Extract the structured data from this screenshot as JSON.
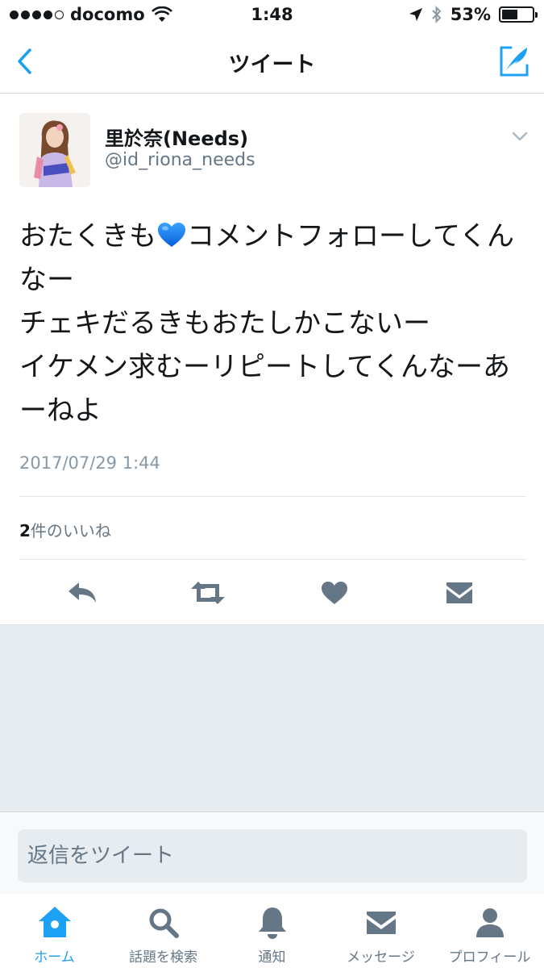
{
  "status_bar": {
    "carrier": "docomo",
    "time": "1:48",
    "battery_percent": "53%",
    "battery_level": 0.53
  },
  "nav": {
    "title": "ツイート",
    "back_icon": "chevron-left-icon",
    "compose_icon": "compose-tweet-icon"
  },
  "tweet": {
    "author_name": "里於奈(Needs)",
    "author_handle": "@id_riona_needs",
    "text_part1": "おたくきも",
    "text_part2": "コメントフォローしてくんなー\nチェキだるきもおたしかこないー\nイケメン求むーリピートしてくんなーあーねよ",
    "timestamp": "2017/07/29 1:44",
    "likes_count": "2",
    "likes_label": "件のいいね"
  },
  "reply": {
    "placeholder": "返信をツイート"
  },
  "tabs": [
    {
      "label": "ホーム",
      "icon": "home-icon",
      "active": true
    },
    {
      "label": "話題を検索",
      "icon": "search-icon",
      "active": false
    },
    {
      "label": "通知",
      "icon": "bell-icon",
      "active": false
    },
    {
      "label": "メッセージ",
      "icon": "envelope-icon",
      "active": false
    },
    {
      "label": "プロフィール",
      "icon": "person-icon",
      "active": false
    }
  ],
  "colors": {
    "accent": "#1da1f2",
    "icon_gray": "#657786",
    "background_gray": "#e6ecf0"
  }
}
